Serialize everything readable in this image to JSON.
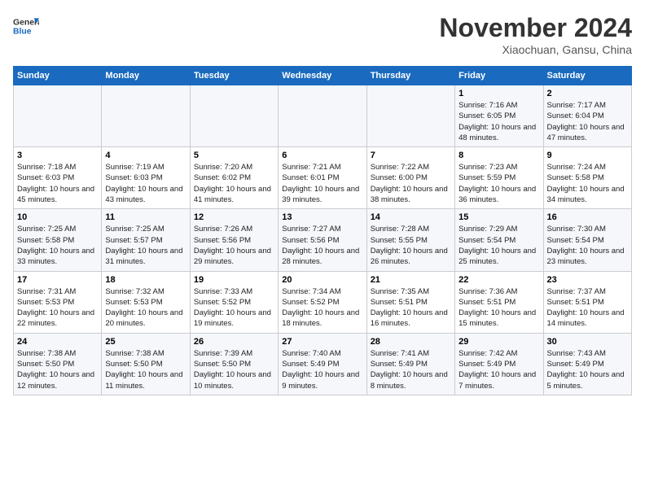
{
  "header": {
    "logo_line1": "General",
    "logo_line2": "Blue",
    "month": "November 2024",
    "location": "Xiaochuan, Gansu, China"
  },
  "weekdays": [
    "Sunday",
    "Monday",
    "Tuesday",
    "Wednesday",
    "Thursday",
    "Friday",
    "Saturday"
  ],
  "weeks": [
    [
      {
        "day": "",
        "info": ""
      },
      {
        "day": "",
        "info": ""
      },
      {
        "day": "",
        "info": ""
      },
      {
        "day": "",
        "info": ""
      },
      {
        "day": "",
        "info": ""
      },
      {
        "day": "1",
        "info": "Sunrise: 7:16 AM\nSunset: 6:05 PM\nDaylight: 10 hours and 48 minutes."
      },
      {
        "day": "2",
        "info": "Sunrise: 7:17 AM\nSunset: 6:04 PM\nDaylight: 10 hours and 47 minutes."
      }
    ],
    [
      {
        "day": "3",
        "info": "Sunrise: 7:18 AM\nSunset: 6:03 PM\nDaylight: 10 hours and 45 minutes."
      },
      {
        "day": "4",
        "info": "Sunrise: 7:19 AM\nSunset: 6:03 PM\nDaylight: 10 hours and 43 minutes."
      },
      {
        "day": "5",
        "info": "Sunrise: 7:20 AM\nSunset: 6:02 PM\nDaylight: 10 hours and 41 minutes."
      },
      {
        "day": "6",
        "info": "Sunrise: 7:21 AM\nSunset: 6:01 PM\nDaylight: 10 hours and 39 minutes."
      },
      {
        "day": "7",
        "info": "Sunrise: 7:22 AM\nSunset: 6:00 PM\nDaylight: 10 hours and 38 minutes."
      },
      {
        "day": "8",
        "info": "Sunrise: 7:23 AM\nSunset: 5:59 PM\nDaylight: 10 hours and 36 minutes."
      },
      {
        "day": "9",
        "info": "Sunrise: 7:24 AM\nSunset: 5:58 PM\nDaylight: 10 hours and 34 minutes."
      }
    ],
    [
      {
        "day": "10",
        "info": "Sunrise: 7:25 AM\nSunset: 5:58 PM\nDaylight: 10 hours and 33 minutes."
      },
      {
        "day": "11",
        "info": "Sunrise: 7:25 AM\nSunset: 5:57 PM\nDaylight: 10 hours and 31 minutes."
      },
      {
        "day": "12",
        "info": "Sunrise: 7:26 AM\nSunset: 5:56 PM\nDaylight: 10 hours and 29 minutes."
      },
      {
        "day": "13",
        "info": "Sunrise: 7:27 AM\nSunset: 5:56 PM\nDaylight: 10 hours and 28 minutes."
      },
      {
        "day": "14",
        "info": "Sunrise: 7:28 AM\nSunset: 5:55 PM\nDaylight: 10 hours and 26 minutes."
      },
      {
        "day": "15",
        "info": "Sunrise: 7:29 AM\nSunset: 5:54 PM\nDaylight: 10 hours and 25 minutes."
      },
      {
        "day": "16",
        "info": "Sunrise: 7:30 AM\nSunset: 5:54 PM\nDaylight: 10 hours and 23 minutes."
      }
    ],
    [
      {
        "day": "17",
        "info": "Sunrise: 7:31 AM\nSunset: 5:53 PM\nDaylight: 10 hours and 22 minutes."
      },
      {
        "day": "18",
        "info": "Sunrise: 7:32 AM\nSunset: 5:53 PM\nDaylight: 10 hours and 20 minutes."
      },
      {
        "day": "19",
        "info": "Sunrise: 7:33 AM\nSunset: 5:52 PM\nDaylight: 10 hours and 19 minutes."
      },
      {
        "day": "20",
        "info": "Sunrise: 7:34 AM\nSunset: 5:52 PM\nDaylight: 10 hours and 18 minutes."
      },
      {
        "day": "21",
        "info": "Sunrise: 7:35 AM\nSunset: 5:51 PM\nDaylight: 10 hours and 16 minutes."
      },
      {
        "day": "22",
        "info": "Sunrise: 7:36 AM\nSunset: 5:51 PM\nDaylight: 10 hours and 15 minutes."
      },
      {
        "day": "23",
        "info": "Sunrise: 7:37 AM\nSunset: 5:51 PM\nDaylight: 10 hours and 14 minutes."
      }
    ],
    [
      {
        "day": "24",
        "info": "Sunrise: 7:38 AM\nSunset: 5:50 PM\nDaylight: 10 hours and 12 minutes."
      },
      {
        "day": "25",
        "info": "Sunrise: 7:38 AM\nSunset: 5:50 PM\nDaylight: 10 hours and 11 minutes."
      },
      {
        "day": "26",
        "info": "Sunrise: 7:39 AM\nSunset: 5:50 PM\nDaylight: 10 hours and 10 minutes."
      },
      {
        "day": "27",
        "info": "Sunrise: 7:40 AM\nSunset: 5:49 PM\nDaylight: 10 hours and 9 minutes."
      },
      {
        "day": "28",
        "info": "Sunrise: 7:41 AM\nSunset: 5:49 PM\nDaylight: 10 hours and 8 minutes."
      },
      {
        "day": "29",
        "info": "Sunrise: 7:42 AM\nSunset: 5:49 PM\nDaylight: 10 hours and 7 minutes."
      },
      {
        "day": "30",
        "info": "Sunrise: 7:43 AM\nSunset: 5:49 PM\nDaylight: 10 hours and 5 minutes."
      }
    ]
  ]
}
